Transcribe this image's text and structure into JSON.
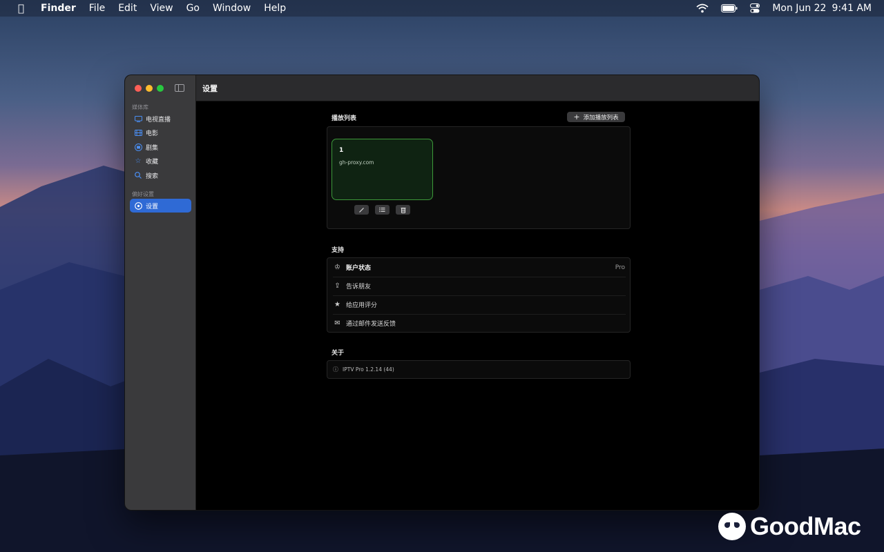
{
  "menubar": {
    "apple_icon": "apple-icon",
    "app_name": "Finder",
    "items": [
      "File",
      "Edit",
      "View",
      "Go",
      "Window",
      "Help"
    ],
    "date": "Mon Jun 22",
    "time": "9:41 AM"
  },
  "window": {
    "title": "设置",
    "sidebar": {
      "section_library": "媒体库",
      "items": [
        {
          "label": "电视直播",
          "icon": "tv-icon"
        },
        {
          "label": "电影",
          "icon": "film-icon"
        },
        {
          "label": "剧集",
          "icon": "series-icon"
        },
        {
          "label": "收藏",
          "icon": "star-icon"
        },
        {
          "label": "搜索",
          "icon": "search-icon"
        }
      ],
      "section_prefs": "偏好设置",
      "settings_item": {
        "label": "设置",
        "icon": "settings-icon"
      }
    },
    "playlists": {
      "title": "播放列表",
      "add_button": "添加播放列表",
      "cards": [
        {
          "name": "1",
          "url": "gh-proxy.com"
        }
      ]
    },
    "support": {
      "title": "支持",
      "rows": [
        {
          "label": "账户状态",
          "value": "Pro",
          "icon": "crown-icon"
        },
        {
          "label": "告诉朋友",
          "icon": "share-icon"
        },
        {
          "label": "给应用评分",
          "icon": "star-rate-icon"
        },
        {
          "label": "通过邮件发送反馈",
          "icon": "mail-icon"
        }
      ]
    },
    "about": {
      "title": "关于",
      "version": "IPTV Pro 1.2.14 (44)"
    }
  },
  "watermark": {
    "text": "GoodMac"
  }
}
